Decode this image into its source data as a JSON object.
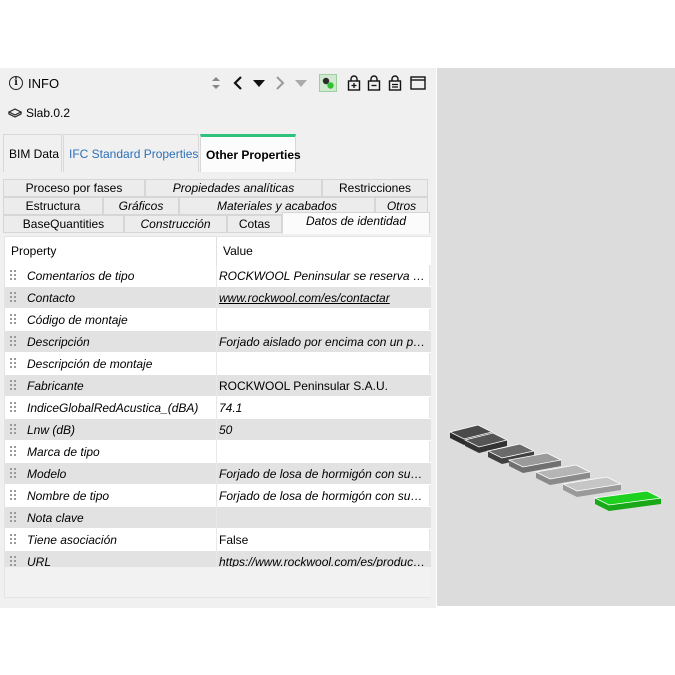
{
  "panel": {
    "title": "INFO",
    "object_name": "Slab.0.2",
    "main_tabs": [
      {
        "label": "BIM Data"
      },
      {
        "label": "IFC Standard Properties"
      },
      {
        "label": "Other Properties"
      }
    ],
    "sub_tabs": {
      "row1": [
        "Proceso por fases",
        "Propiedades analíticas",
        "Restricciones"
      ],
      "row2": [
        "Estructura",
        "Gráficos",
        "Materiales y acabados",
        "Otros"
      ],
      "row3": [
        "BaseQuantities",
        "Construcción",
        "Cotas",
        "Datos de identidad"
      ]
    },
    "table": {
      "header_property": "Property",
      "header_value": "Value",
      "rows": [
        {
          "name": "Comentarios de tipo",
          "value": "ROCKWOOL Peninsular se reserva el derecho a modificar"
        },
        {
          "name": "Contacto",
          "value": "www.rockwool.com/es/contactar"
        },
        {
          "name": "Código de montaje",
          "value": ""
        },
        {
          "name": "Descripción",
          "value": "Forjado aislado por encima con un panel"
        },
        {
          "name": "Descripción de montaje",
          "value": ""
        },
        {
          "name": "Fabricante",
          "value": "ROCKWOOL Peninsular S.A.U."
        },
        {
          "name": "IndiceGlobalRedAcustica_(dBA)",
          "value": "74.1"
        },
        {
          "name": "Lnw (dB)",
          "value": "50"
        },
        {
          "name": "Marca de tipo",
          "value": ""
        },
        {
          "name": "Modelo",
          "value": "Forjado de losa de hormigón con suelo flotante"
        },
        {
          "name": "Nombre de tipo",
          "value": "Forjado de losa de hormigón con suelo flotante"
        },
        {
          "name": "Nota clave",
          "value": ""
        },
        {
          "name": "Tiene asociación",
          "value": "False"
        },
        {
          "name": "URL",
          "value": "https://www.rockwool.com/es/productos"
        }
      ]
    }
  },
  "colors": {
    "active_tab_accent": "#2ec27e",
    "link_tab": "#2d6fb8",
    "selected_slab": "#1fd11f",
    "viewport_bg": "#dcdcdc"
  }
}
